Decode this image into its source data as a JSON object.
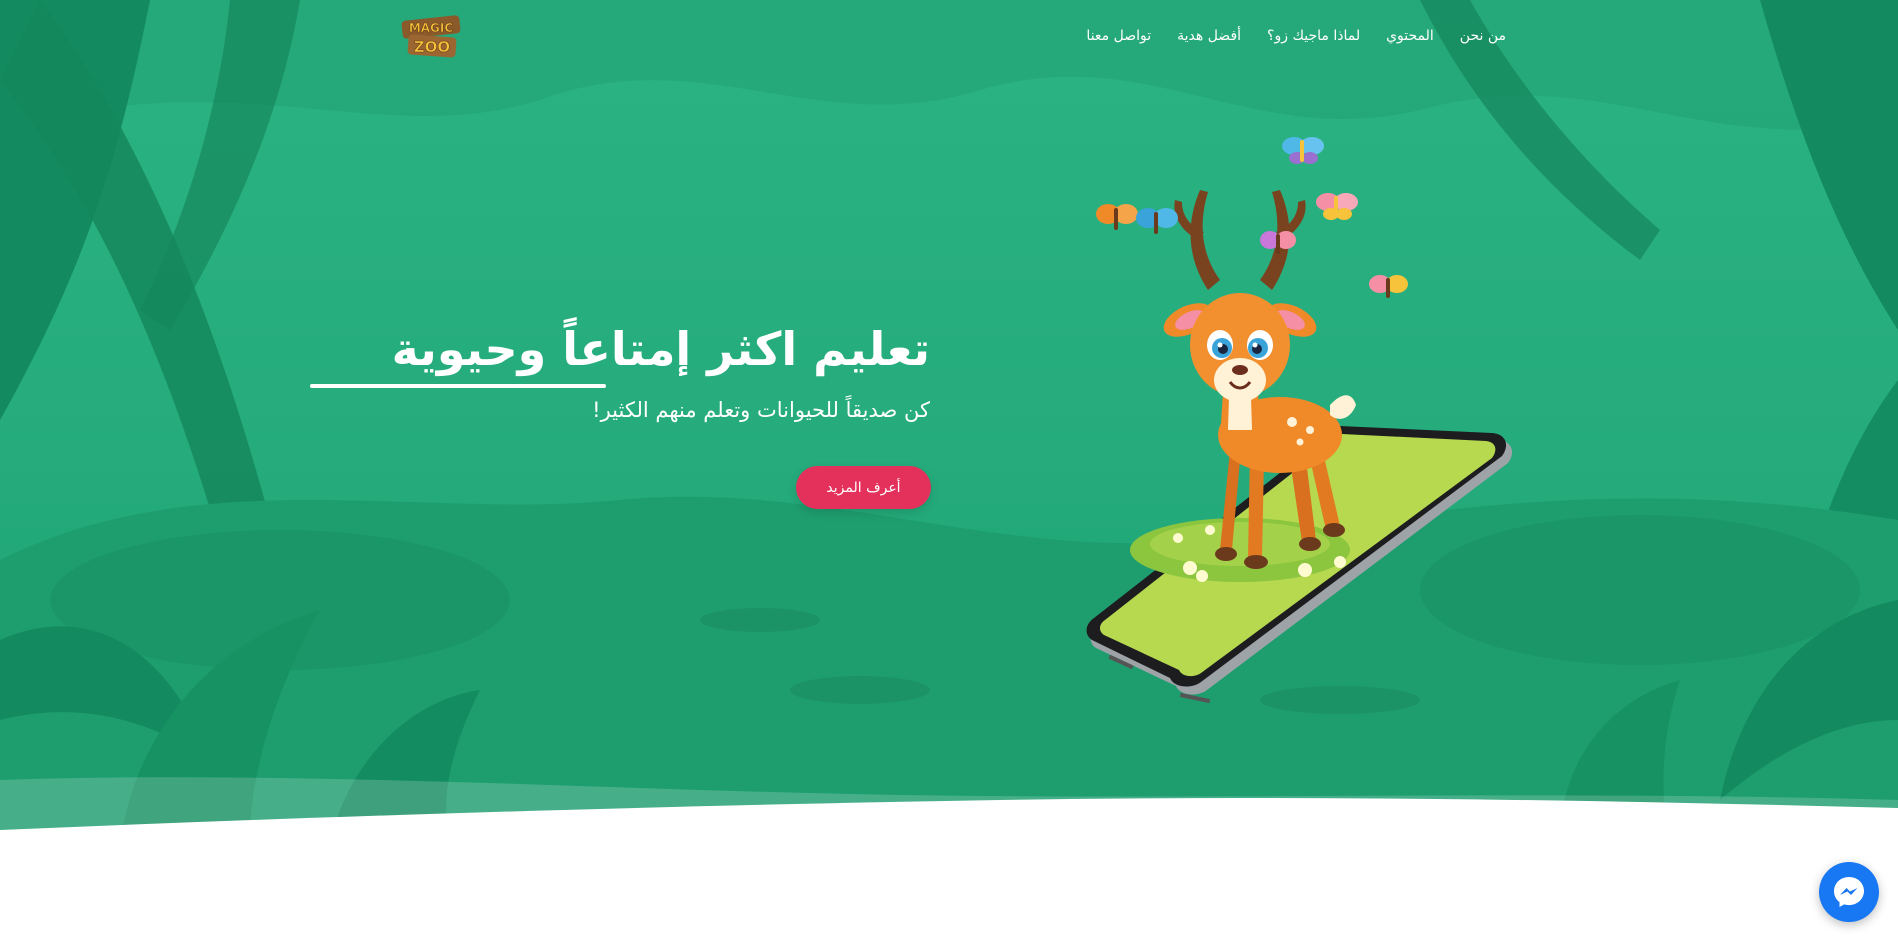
{
  "brand": {
    "logo_line1": "MAGIC",
    "logo_line2": "ZOO"
  },
  "nav": {
    "items": [
      {
        "label": "تواصل معنا"
      },
      {
        "label": "أفضل هدية"
      },
      {
        "label": "لماذا ماجيك زو؟"
      },
      {
        "label": "المحتوي"
      },
      {
        "label": "من نحن"
      }
    ]
  },
  "hero": {
    "headline": "تعليم اكثر إمتاعاً وحيوية",
    "subtitle": "كن صديقاً للحيوانات وتعلم منهم الكثير!",
    "cta_label": "أعرف المزيد"
  },
  "icons": {
    "messenger": "messenger-icon"
  },
  "colors": {
    "jungle_green": "#23a878",
    "jungle_dark": "#15865e",
    "cta": "#e4315b",
    "messenger": "#1877f2",
    "phone_screen": "#b6d94f"
  }
}
